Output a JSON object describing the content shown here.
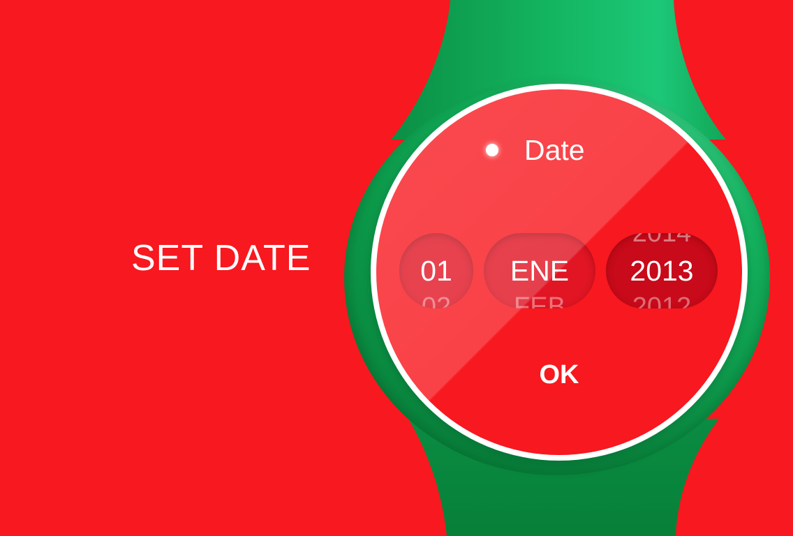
{
  "headline": "SET DATE",
  "watch": {
    "title": "Date",
    "day_picker": {
      "prev": "",
      "current": "01",
      "next": "02"
    },
    "month_picker": {
      "prev": "",
      "current": "ENE",
      "next": "FEB"
    },
    "year_picker": {
      "prev": "2014",
      "current": "2013",
      "next": "2012"
    },
    "ok_label": "OK"
  },
  "colors": {
    "background": "#f8181f",
    "strap_green": "#15b862",
    "face_red": "#f8181f",
    "year_pill": "#c80a1a",
    "text": "#ffffff"
  },
  "icons": {
    "status": "dot-icon"
  }
}
